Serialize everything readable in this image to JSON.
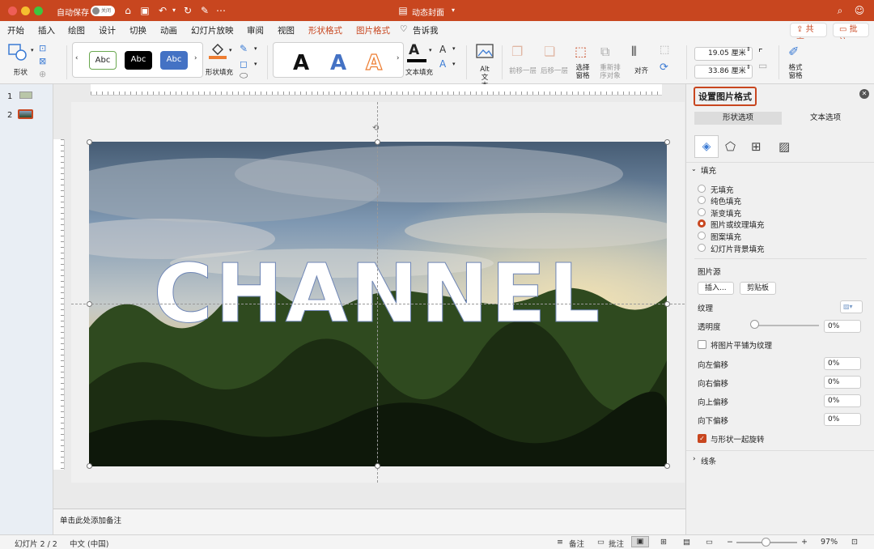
{
  "titlebar": {
    "autosave_label": "自动保存",
    "autosave_state": "关闭",
    "doc_title": "动态封面",
    "accent": "#c8461f"
  },
  "menu": {
    "tabs": [
      "开始",
      "插入",
      "绘图",
      "设计",
      "切换",
      "动画",
      "幻灯片放映",
      "审阅",
      "视图",
      "形状格式",
      "图片格式",
      "告诉我"
    ],
    "active_tabs": [
      "形状格式",
      "图片格式"
    ],
    "share_label": "共享",
    "comments_label": "批注"
  },
  "ribbon": {
    "shape_label": "形状",
    "style_samples": [
      "Abc",
      "Abc",
      "Abc"
    ],
    "shape_fill_label": "形状填充",
    "wordart_letters": [
      "A",
      "A",
      "A"
    ],
    "text_fill_label": "文本填充",
    "alt_text_label": "Alt 文本",
    "bring_forward_label": "前移一层",
    "send_backward_label": "后移一层",
    "selection_pane_label": "选择窗格",
    "reorder_label": "重新排序对象",
    "align_label": "对齐",
    "height_value": "19.05 厘米",
    "width_value": "33.86 厘米",
    "format_pane_label": "格式窗格"
  },
  "thumbs": {
    "slide_numbers": [
      "1",
      "2"
    ]
  },
  "slide": {
    "overlay_text": "CHANNEL"
  },
  "notes": {
    "placeholder": "单击此处添加备注"
  },
  "pane": {
    "title": "设置图片格式",
    "tab_shape": "形状选项",
    "tab_text": "文本选项",
    "fill_section": "填充",
    "fill_options": [
      "无填充",
      "纯色填充",
      "渐变填充",
      "图片或纹理填充",
      "图案填充",
      "幻灯片背景填充"
    ],
    "selected_fill": "图片或纹理填充",
    "picture_source_label": "图片源",
    "insert_button": "插入...",
    "clipboard_button": "剪贴板",
    "texture_label": "纹理",
    "transparency_label": "透明度",
    "transparency_value": "0%",
    "tile_label": "将图片平铺为纹理",
    "offset_left_label": "向左偏移",
    "offset_right_label": "向右偏移",
    "offset_top_label": "向上偏移",
    "offset_bottom_label": "向下偏移",
    "offset_left_value": "0%",
    "offset_right_value": "0%",
    "offset_top_value": "0%",
    "offset_bottom_value": "0%",
    "rotate_label": "与形状一起旋转",
    "rotate_checked": true,
    "line_section": "线条"
  },
  "status": {
    "slide_indicator": "幻灯片 2 / 2",
    "language": "中文 (中国)",
    "notes_label": "备注",
    "comments_label": "批注",
    "zoom": "97%"
  }
}
